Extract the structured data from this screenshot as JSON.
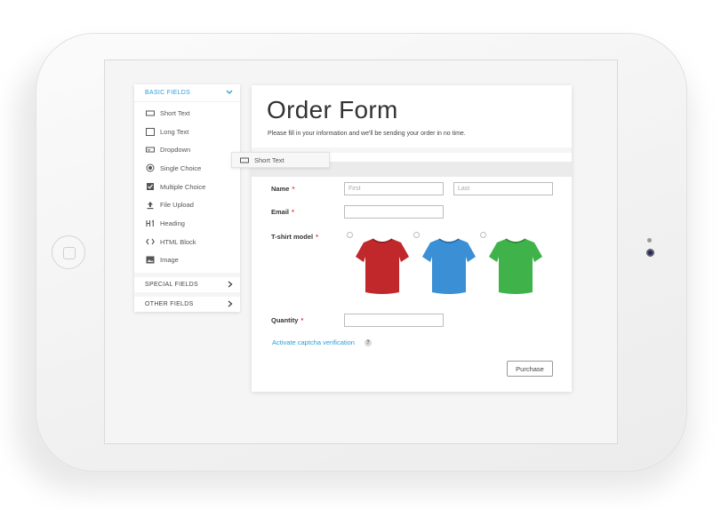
{
  "sidebar": {
    "basic_header": "BASIC FIELDS",
    "items": [
      {
        "label": "Short Text",
        "icon": "short-text-icon"
      },
      {
        "label": "Long Text",
        "icon": "long-text-icon"
      },
      {
        "label": "Dropdown",
        "icon": "dropdown-icon"
      },
      {
        "label": "Single Choice",
        "icon": "radio-icon"
      },
      {
        "label": "Multiple Choice",
        "icon": "checkbox-icon"
      },
      {
        "label": "File Upload",
        "icon": "upload-icon"
      },
      {
        "label": "Heading",
        "icon": "heading-icon"
      },
      {
        "label": "HTML Block",
        "icon": "code-icon"
      },
      {
        "label": "Image",
        "icon": "image-icon"
      }
    ],
    "special_header": "SPECIAL FIELDS",
    "other_header": "OTHER FIELDS"
  },
  "drag_chip": {
    "label": "Short Text"
  },
  "form": {
    "title": "Order Form",
    "subtitle": "Please fill in your information and we'll be sending your order in no time.",
    "fields": {
      "name_label": "Name",
      "first_placeholder": "First",
      "last_placeholder": "Last",
      "email_label": "Email",
      "tshirt_label": "T-shirt model",
      "tshirt_colors": [
        "#c0282c",
        "#3b8fd4",
        "#3fb34a"
      ],
      "quantity_label": "Quantity"
    },
    "captcha_link": "Activate captcha verification",
    "help_icon": "?",
    "purchase_label": "Purchase"
  },
  "colors": {
    "accent": "#2a9fd6",
    "required": "#e23b3b"
  }
}
